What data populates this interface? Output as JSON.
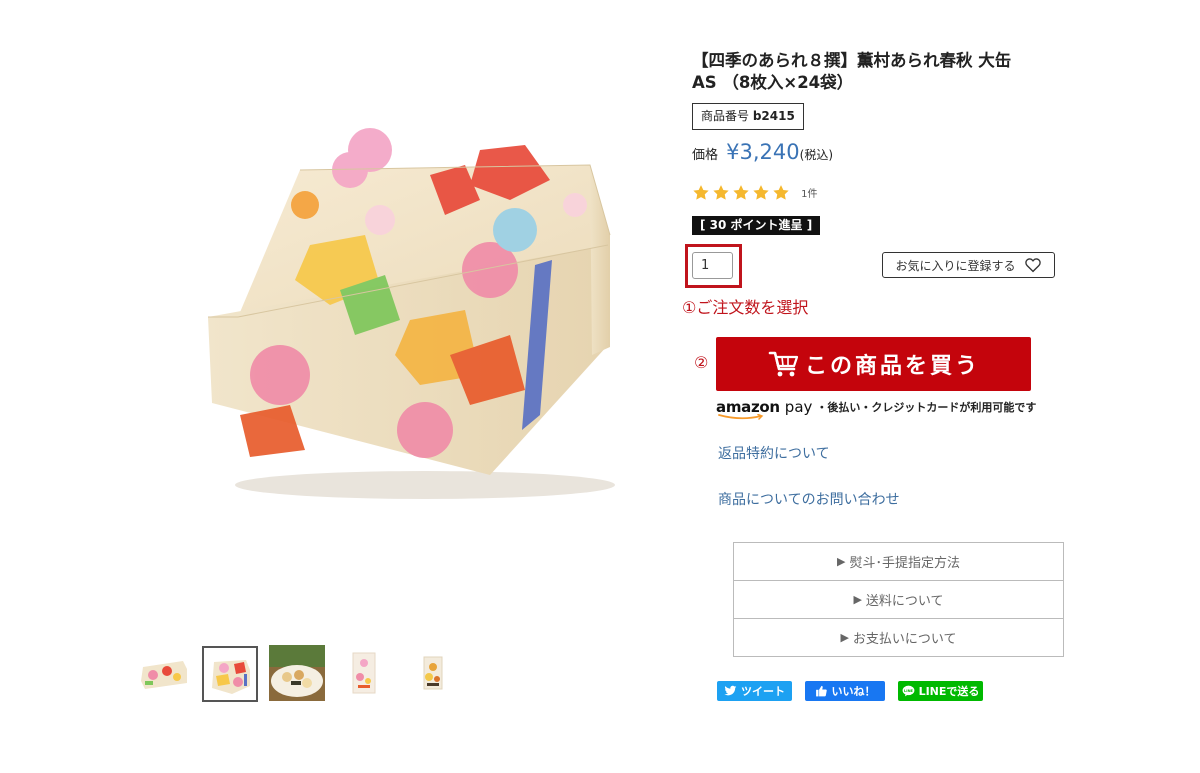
{
  "product": {
    "title_line1": "【四季のあられ８撰】薫村あられ春秋 大缶",
    "title_line2": "AS （8枚入×24袋）",
    "sku_label": "商品番号",
    "sku_value": "b2415",
    "price_label": "価格",
    "price_value": "¥3,240",
    "price_tax": "(税込)",
    "rating": 5,
    "rating_count": "1件",
    "points_badge": "[ 30 ポイント進呈 ]"
  },
  "purchase": {
    "quantity_value": "1",
    "favorite_label": "お気に入りに登録する",
    "step1_note": "①ご注文数を選択",
    "step2_marker": "②",
    "buy_label": "この商品を買う",
    "amazon_logo": "amazon",
    "amazon_pay": "pay",
    "amazon_text": "・後払い・クレジットカードが利用可能です"
  },
  "links": {
    "returns": "返品特約について",
    "contact": "商品についてのお問い合わせ"
  },
  "accordion": [
    {
      "label": "熨斗･手提指定方法"
    },
    {
      "label": "送料について"
    },
    {
      "label": "お支払いについて"
    }
  ],
  "share": {
    "tweet": "ツイート",
    "like": "いいね！",
    "line": "LINEで送る"
  },
  "gallery": {
    "selected_index": 1,
    "thumbnail_count": 5
  },
  "colors": {
    "price": "#3a73b5",
    "buy_button": "#c4040c",
    "annotation_red": "#c0141c",
    "link": "#3e6e9f",
    "star": "#f5b82e",
    "twitter": "#1da1f2",
    "facebook": "#1877f2",
    "line": "#00b900"
  }
}
